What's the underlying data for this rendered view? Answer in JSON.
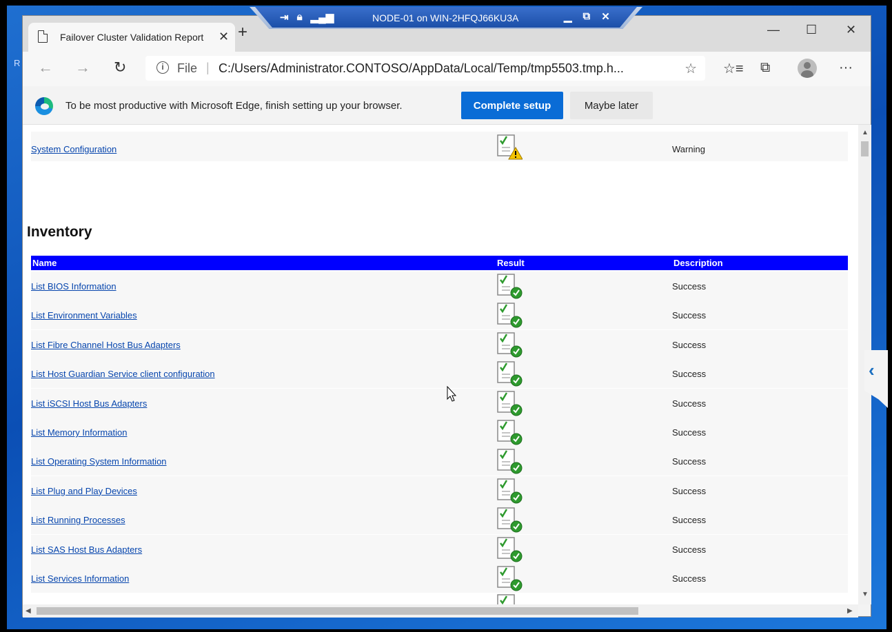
{
  "rdp_bar": {
    "title": "NODE-01 on WIN-2HFQJ66KU3A",
    "icons": [
      "pin-icon",
      "lock-icon",
      "signal-icon"
    ],
    "controls": [
      "minimize-icon",
      "restore-icon",
      "close-icon"
    ]
  },
  "desktop": {
    "left_label": "R"
  },
  "browser": {
    "tab_title": "Failover Cluster Validation Report",
    "address_scheme": "File",
    "address_url": "C:/Users/Administrator.CONTOSO/AppData/Local/Temp/tmp5503.tmp.h..."
  },
  "promo": {
    "text": "To be most productive with Microsoft Edge, finish setting up your browser.",
    "primary_button": "Complete setup",
    "secondary_button": "Maybe later"
  },
  "report": {
    "prev_row": {
      "name": "System Configuration",
      "result": "warning",
      "description": "Warning"
    },
    "section_title": "Inventory",
    "columns": {
      "name": "Name",
      "result": "Result",
      "description": "Description"
    },
    "rows": [
      {
        "name": "List BIOS Information",
        "result": "success",
        "description": "Success"
      },
      {
        "name": "List Environment Variables",
        "result": "success",
        "description": "Success"
      },
      {
        "name": "List Fibre Channel Host Bus Adapters",
        "result": "success",
        "description": "Success"
      },
      {
        "name": "List Host Guardian Service client configuration",
        "result": "success",
        "description": "Success"
      },
      {
        "name": "List iSCSI Host Bus Adapters",
        "result": "success",
        "description": "Success"
      },
      {
        "name": "List Memory Information",
        "result": "success",
        "description": "Success"
      },
      {
        "name": "List Operating System Information",
        "result": "success",
        "description": "Success"
      },
      {
        "name": "List Plug and Play Devices",
        "result": "success",
        "description": "Success"
      },
      {
        "name": "List Running Processes",
        "result": "success",
        "description": "Success"
      },
      {
        "name": "List SAS Host Bus Adapters",
        "result": "success",
        "description": "Success"
      },
      {
        "name": "List Services Information",
        "result": "success",
        "description": "Success"
      }
    ]
  },
  "colors": {
    "table_header": "#0000ff",
    "link": "#0645ad",
    "accent_button": "#0a6cd6",
    "success": "#2e9a2e",
    "warning": "#f5c400"
  }
}
